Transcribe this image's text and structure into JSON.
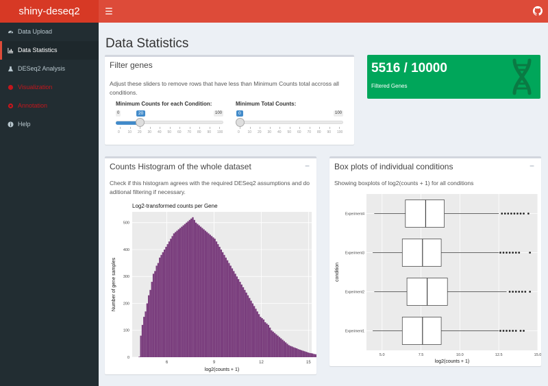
{
  "app": {
    "title": "shiny-deseq2"
  },
  "sidebar": {
    "items": [
      {
        "label": "Data Upload",
        "icon": "dashboard-icon"
      },
      {
        "label": "Data Statistics",
        "icon": "bar-chart-icon"
      },
      {
        "label": "DESeq2 Analysis",
        "icon": "flask-icon"
      },
      {
        "label": "Visualization",
        "icon": "chart-icon"
      },
      {
        "label": "Annotation",
        "icon": "gear-icon"
      },
      {
        "label": "Help",
        "icon": "info-icon"
      }
    ]
  },
  "page": {
    "title": "Data Statistics"
  },
  "filter": {
    "title": "Filter genes",
    "desc": "Adjust these sliders to remove rows that have less than Minimum Counts total accross all conditions.",
    "slider1": {
      "label": "Minimum Counts for each Condition:",
      "min": "0",
      "max": "100",
      "value": "20",
      "value_num": 20
    },
    "slider2": {
      "label": "Minimum Total Counts:",
      "min": "0",
      "max": "100",
      "value": "0",
      "value_num": 0
    },
    "ticks": [
      "0",
      "10",
      "20",
      "30",
      "40",
      "50",
      "60",
      "70",
      "80",
      "90",
      "100"
    ]
  },
  "valuebox": {
    "value": "5516 / 10000",
    "subtitle": "Filtered Genes",
    "color": "#00a65a",
    "icon": "dna-icon"
  },
  "hist_box": {
    "title": "Counts Histogram of the whole dataset",
    "desc": "Check if this histogram agrees with the required DESeq2 assumptions and do aditional filtering if necessary.",
    "collapse": "−"
  },
  "box_box": {
    "title": "Box plots of individual conditions",
    "desc": "Showing boxplots of log2(counts + 1) for all conditions",
    "collapse": "−"
  },
  "chart_data": [
    {
      "type": "bar",
      "title": "Log2-transformed counts per Gene",
      "xlabel": "log2(counts + 1)",
      "ylabel": "Number of gene samples",
      "xlim": [
        3.8,
        15.2
      ],
      "ylim": [
        0,
        540
      ],
      "xticks": [
        "6",
        "9",
        "12",
        "15"
      ],
      "yticks": [
        "0",
        "100",
        "200",
        "300",
        "400",
        "500"
      ],
      "color": "#7b3f7e",
      "bin_start": 4.2,
      "bin_width": 0.1,
      "values": [
        2,
        80,
        120,
        150,
        170,
        200,
        230,
        250,
        280,
        310,
        320,
        340,
        350,
        370,
        380,
        390,
        400,
        410,
        420,
        430,
        440,
        450,
        460,
        465,
        470,
        475,
        480,
        485,
        490,
        495,
        500,
        505,
        510,
        515,
        520,
        510,
        500,
        495,
        490,
        485,
        480,
        475,
        470,
        465,
        460,
        455,
        450,
        445,
        440,
        430,
        420,
        410,
        400,
        390,
        380,
        370,
        360,
        350,
        340,
        330,
        320,
        310,
        300,
        290,
        280,
        270,
        260,
        250,
        240,
        230,
        220,
        210,
        200,
        190,
        180,
        170,
        160,
        150,
        145,
        140,
        130,
        125,
        120,
        110,
        100,
        95,
        90,
        85,
        80,
        75,
        70,
        65,
        60,
        55,
        50,
        45,
        42,
        40,
        37,
        35,
        33,
        30,
        28,
        26,
        24,
        22,
        20,
        18,
        16,
        15,
        14,
        12,
        11,
        10,
        9,
        8,
        8,
        7,
        6,
        6,
        5,
        5,
        4,
        4,
        3,
        3,
        3,
        2,
        2,
        2,
        2,
        1,
        1,
        1,
        1,
        1
      ]
    },
    {
      "type": "boxplot",
      "xlabel": "log2(counts + 1)",
      "ylabel": "condition",
      "xlim": [
        4.0,
        15.0
      ],
      "xticks": [
        "5.0",
        "7.5",
        "10.0",
        "12.5",
        "15.0"
      ],
      "series": [
        {
          "name": "Experiment4",
          "whisker_low": 4.5,
          "q1": 6.5,
          "median": 7.8,
          "q3": 9.0,
          "whisker_high": 12.5,
          "outliers": [
            12.7,
            12.9,
            13.1,
            13.3,
            13.5,
            13.7,
            13.9,
            14.1,
            14.4
          ]
        },
        {
          "name": "Experiment3",
          "whisker_low": 4.4,
          "q1": 6.3,
          "median": 7.6,
          "q3": 8.8,
          "whisker_high": 12.5,
          "outliers": [
            12.6,
            12.8,
            13.0,
            13.2,
            13.4,
            13.6,
            13.8,
            14.5
          ]
        },
        {
          "name": "Experiment2",
          "whisker_low": 4.5,
          "q1": 6.6,
          "median": 7.9,
          "q3": 9.2,
          "whisker_high": 13.0,
          "outliers": [
            13.2,
            13.4,
            13.6,
            13.8,
            14.0,
            14.2,
            14.5
          ]
        },
        {
          "name": "Experiment1",
          "whisker_low": 4.4,
          "q1": 6.3,
          "median": 7.6,
          "q3": 8.8,
          "whisker_high": 12.5,
          "outliers": [
            12.6,
            12.8,
            13.0,
            13.2,
            13.4,
            13.6,
            13.9,
            14.1
          ]
        }
      ]
    }
  ]
}
